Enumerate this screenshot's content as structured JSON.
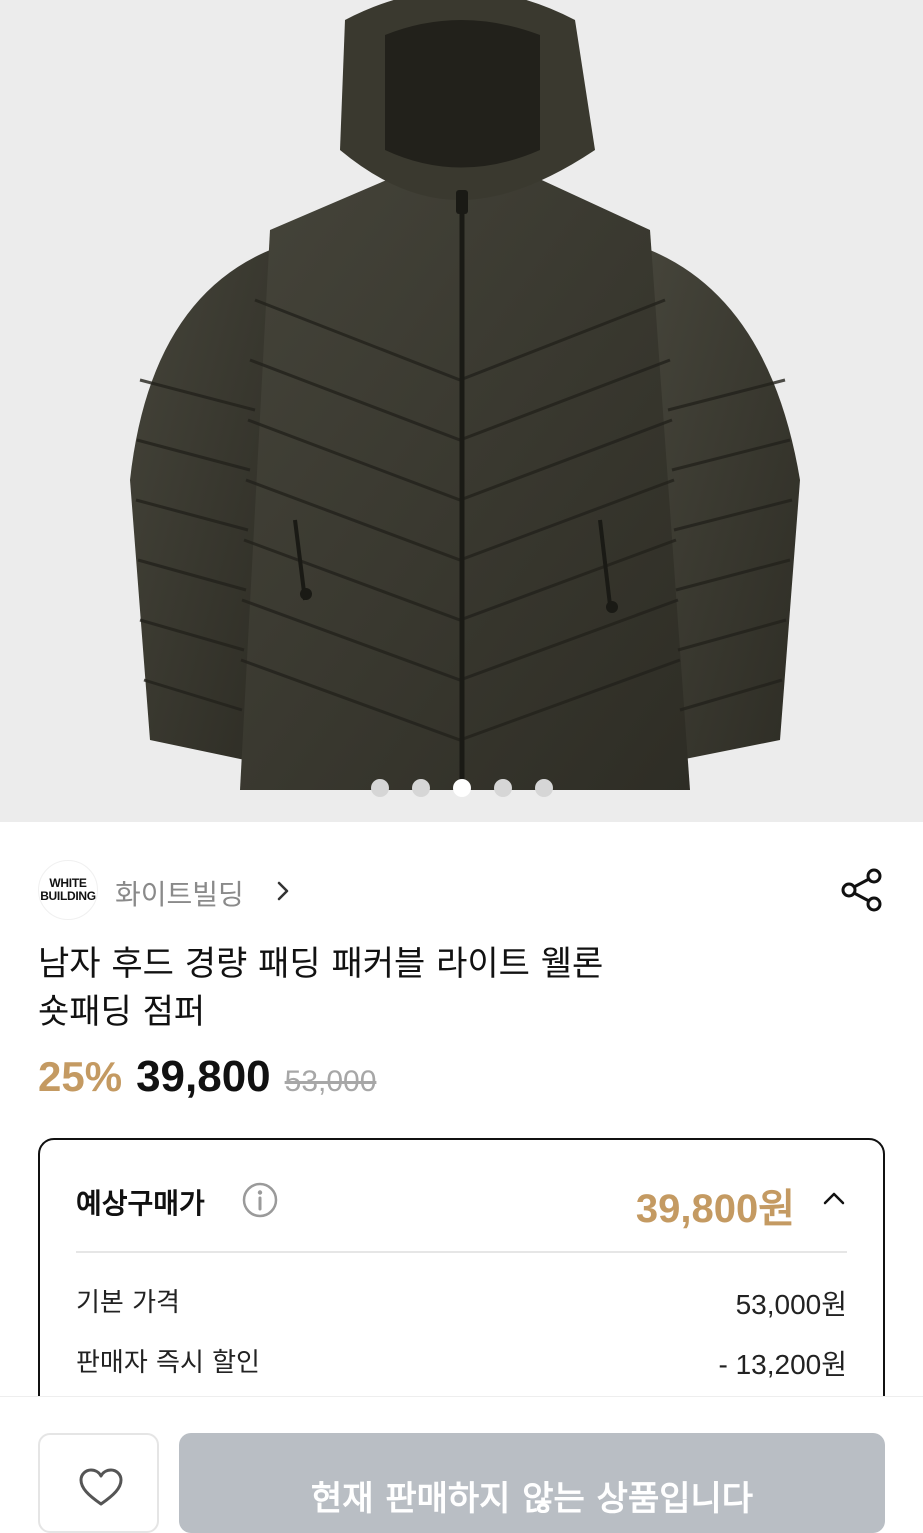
{
  "hero": {
    "image_alt": "product-photo",
    "carousel": {
      "count": 5,
      "active_index": 2
    }
  },
  "brand": {
    "logo_line1": "WHITE",
    "logo_line2": "BUILDING",
    "name": "화이트빌딩"
  },
  "product": {
    "title_line1": "남자 후드 경량 패딩 패커블 라이트 웰론",
    "title_line2": "숏패딩 점퍼",
    "discount": "25%",
    "price": "39,800",
    "original_price": "53,000"
  },
  "estimate": {
    "title": "예상구매가",
    "total": "39,800원",
    "lines": [
      {
        "label": "기본 가격",
        "value": "53,000원"
      },
      {
        "label": "판매자 즉시 할인",
        "value": "- 13,200원"
      }
    ]
  },
  "bottom": {
    "buy_label": "현재 판매하지 않는 상품입니다"
  },
  "colors": {
    "accent": "#c49a62",
    "disabled_button": "#b9bec4",
    "jacket": "#3b3a2e"
  }
}
